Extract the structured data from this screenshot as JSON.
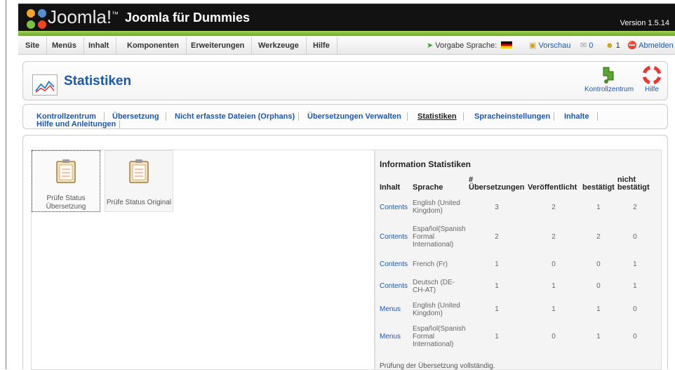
{
  "header": {
    "logo_text": "Joomla!",
    "logo_mark": "™",
    "site_title": "Joomla für Dummies",
    "version": "Version 1.5.14"
  },
  "menu": {
    "items": [
      "Site",
      "Menüs",
      "Inhalt",
      "Komponenten",
      "Erweiterungen",
      "Werkzeuge",
      "Hilfe"
    ]
  },
  "status": {
    "default_language": "Vorgabe Sprache:",
    "preview": "Vorschau",
    "messages": "0",
    "users": "1",
    "logout": "Abmelden",
    "colors": {
      "flag": "german-flag",
      "logout_icon": "#d11"
    }
  },
  "toolbar": {
    "title": "Statistiken",
    "control_center": "Kontrollzentrum",
    "help": "Hilfe"
  },
  "submenu": {
    "items": [
      {
        "label": "Kontrollzentrum",
        "active": false
      },
      {
        "label": "Übersetzung",
        "active": false
      },
      {
        "label": "Nicht erfasste Dateien (Orphans)",
        "active": false
      },
      {
        "label": "Übersetzungen Verwalten",
        "active": false
      },
      {
        "label": "Statistiken",
        "active": true
      },
      {
        "label": "Spracheinstellungen",
        "active": false
      },
      {
        "label": "Inhalte",
        "active": false
      },
      {
        "label": "Hilfe und Anleitungen",
        "active": false
      }
    ]
  },
  "quick_buttons": [
    {
      "label": "Prüfe Status Übersetzung",
      "icon": "clipboard-icon"
    },
    {
      "label": "Prüfe Status Original",
      "icon": "clipboard-icon"
    }
  ],
  "stats": {
    "title": "Information Statistiken",
    "headers": {
      "content": "Inhalt",
      "language": "Sprache",
      "count_symbol": "#",
      "translations": "Übersetzungen",
      "published": "Veröffentlicht",
      "confirmed": "bestätigt",
      "not_confirmed": "nicht bestätigt"
    },
    "rows": [
      {
        "content": "Contents",
        "language": "English (United Kingdom)",
        "translations": "3",
        "published": "2",
        "confirmed": "1",
        "unconfirmed": "2"
      },
      {
        "content": "Contents",
        "language": "Español(Spanish Formal International)",
        "translations": "2",
        "published": "2",
        "confirmed": "2",
        "unconfirmed": "0"
      },
      {
        "content": "Contents",
        "language": "French (Fr)",
        "translations": "1",
        "published": "0",
        "confirmed": "0",
        "unconfirmed": "1"
      },
      {
        "content": "Contents",
        "language": "Deutsch (DE-CH-AT)",
        "translations": "1",
        "published": "1",
        "confirmed": "0",
        "unconfirmed": "1"
      },
      {
        "content": "Menus",
        "language": "English (United Kingdom)",
        "translations": "1",
        "published": "1",
        "confirmed": "1",
        "unconfirmed": "0"
      },
      {
        "content": "Menus",
        "language": "Español(Spanish Formal International)",
        "translations": "1",
        "published": "0",
        "confirmed": "1",
        "unconfirmed": "0"
      }
    ],
    "footer_note": "Prüfung der Übersetzung vollständig."
  }
}
